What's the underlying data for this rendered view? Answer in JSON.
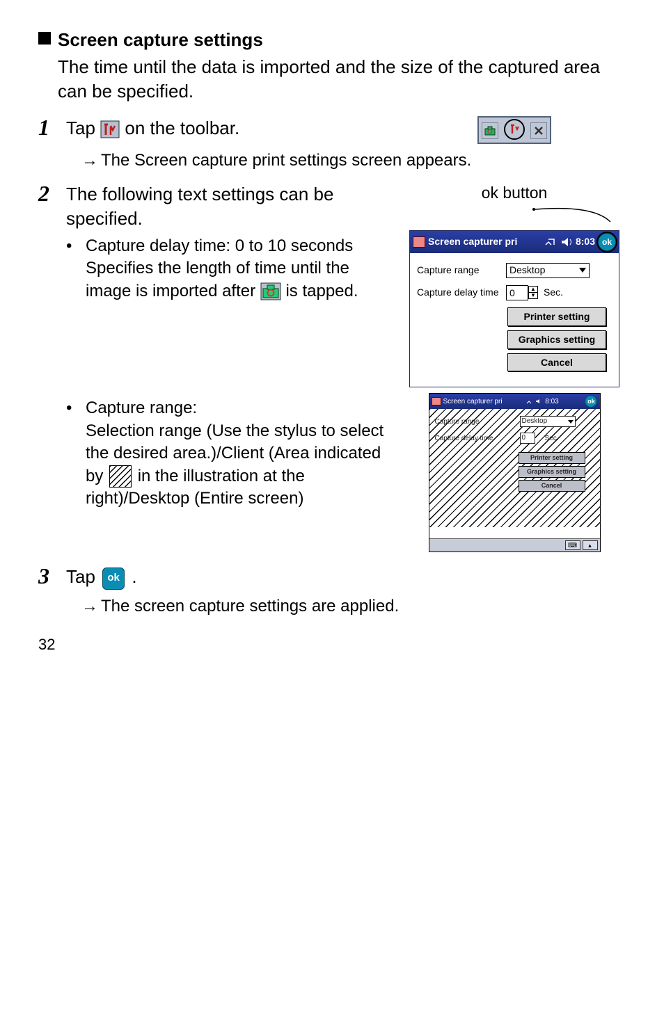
{
  "section": {
    "title": "Screen capture settings"
  },
  "intro": "The time until the data is imported and the size of the captured area can be specified.",
  "step1": {
    "before": "Tap ",
    "after": " on the toolbar.",
    "result": "The Screen capture print settings screen appears."
  },
  "step2": {
    "text": "The following text settings can be specified.",
    "ok_label": "ok button",
    "bullet1_title": "Capture delay time: 0 to 10 seconds",
    "bullet1_body_before": "Specifies the length of time until the image is imported after ",
    "bullet1_body_after": " is tapped.",
    "bullet2_title": "Capture range:",
    "bullet2_body1": "Selection range (Use the stylus to select the desired area.)/Client (Area indicated by",
    "bullet2_body2": "in the illustration at the right)/Desktop (Entire screen)"
  },
  "captwin": {
    "title": "Screen capturer pri",
    "time": "8:03",
    "label_range": "Capture range",
    "label_delay": "Capture delay time",
    "range_value": "Desktop",
    "delay_value": "0",
    "delay_unit": "Sec.",
    "btn_printer": "Printer setting",
    "btn_graphics": "Graphics setting",
    "btn_cancel": "Cancel"
  },
  "clientwin": {
    "title": "Screen capturer pri",
    "time": "8:03",
    "label_range": "Capture range",
    "label_delay": "Capture delay time",
    "range_value": "Desktop",
    "delay_value": "0",
    "delay_unit": "Sec.",
    "btn_printer": "Printer setting",
    "btn_graphics": "Graphics setting",
    "btn_cancel": "Cancel"
  },
  "step3": {
    "before": "Tap ",
    "after": ".",
    "result": "The screen capture settings are applied."
  },
  "page_number": "32",
  "icons": {
    "toolbar": "toolbar-icon",
    "camera": "camera-icon",
    "ok": "ok"
  }
}
